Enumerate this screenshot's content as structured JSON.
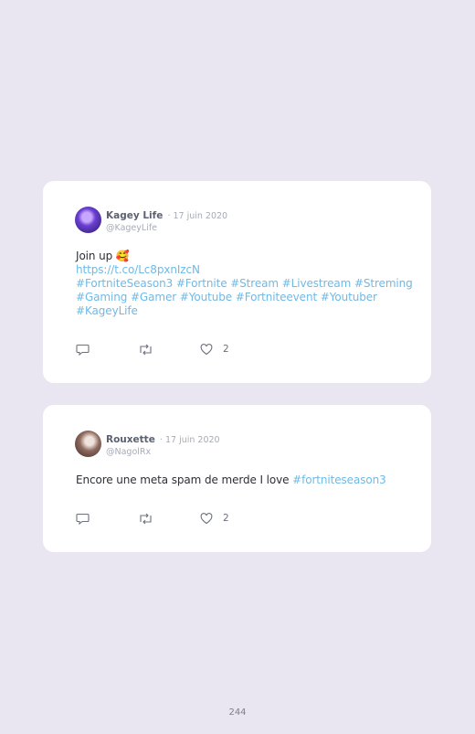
{
  "tweets": [
    {
      "name": "Kagey Life",
      "date": "· 17 juin 2020",
      "handle": "@KageyLife",
      "text_line1": "Join up 🥰",
      "link": "https://t.co/Lc8pxnIzcN",
      "hashtags": "#FortniteSeason3 #Fortnite #Stream #Livestream #Streming #Gaming #Gamer #Youtube #Fortniteevent #Youtuber #KageyLife",
      "likes": "2"
    },
    {
      "name": "Rouxette",
      "date": "· 17 juin 2020",
      "handle": "@NagolRx",
      "text": "Encore une meta spam de merde I love",
      "hashtag": "#fortniteseason3",
      "likes": "2"
    }
  ],
  "page_number": "244",
  "icons": [
    "reply-icon",
    "retweet-icon",
    "heart-icon"
  ]
}
